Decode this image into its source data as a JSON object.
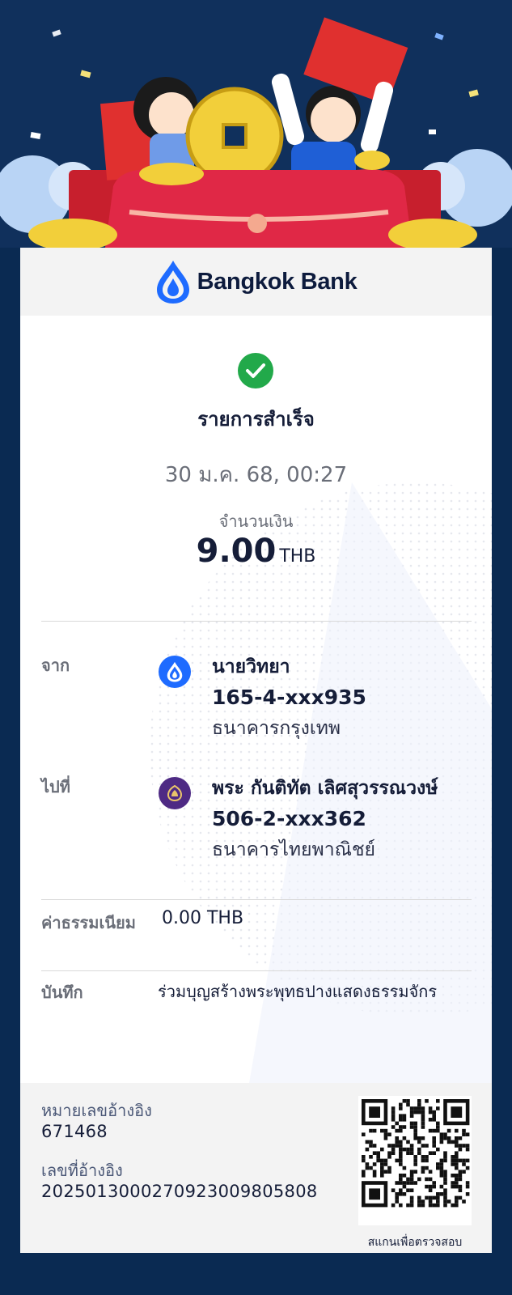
{
  "brand": {
    "name": "Bangkok Bank",
    "color": "#1e6bff"
  },
  "status": {
    "text": "รายการสำเร็จ",
    "color": "#22a94a"
  },
  "datetime": "30 ม.ค. 68, 00:27",
  "amount": {
    "label": "จำนวนเงิน",
    "value": "9.00",
    "currency": "THB"
  },
  "from": {
    "label": "จาก",
    "name": "นายวิทยา",
    "account": "165-4-xxx935",
    "bank": "ธนาคารกรุงเทพ",
    "icon": "bangkok-bank-icon"
  },
  "to": {
    "label": "ไปที่",
    "name": "พระ กันติทัต เลิศสุวรรณวงษ์",
    "account": "506-2-xxx362",
    "bank": "ธนาคารไทยพาณิชย์",
    "icon": "scb-bank-icon"
  },
  "fee": {
    "label": "ค่าธรรมเนียม",
    "value": "0.00 THB"
  },
  "memo": {
    "label": "บันทึก",
    "value": "ร่วมบุญสร้างพระพุทธปางแสดงธรรมจักร"
  },
  "reference": {
    "label1": "หมายเลขอ้างอิง",
    "value1": "671468",
    "label2": "เลขที่อ้างอิง",
    "value2": "2025013000270923009805808"
  },
  "qr": {
    "caption": "สแกนเพื่อตรวจสอบ"
  }
}
